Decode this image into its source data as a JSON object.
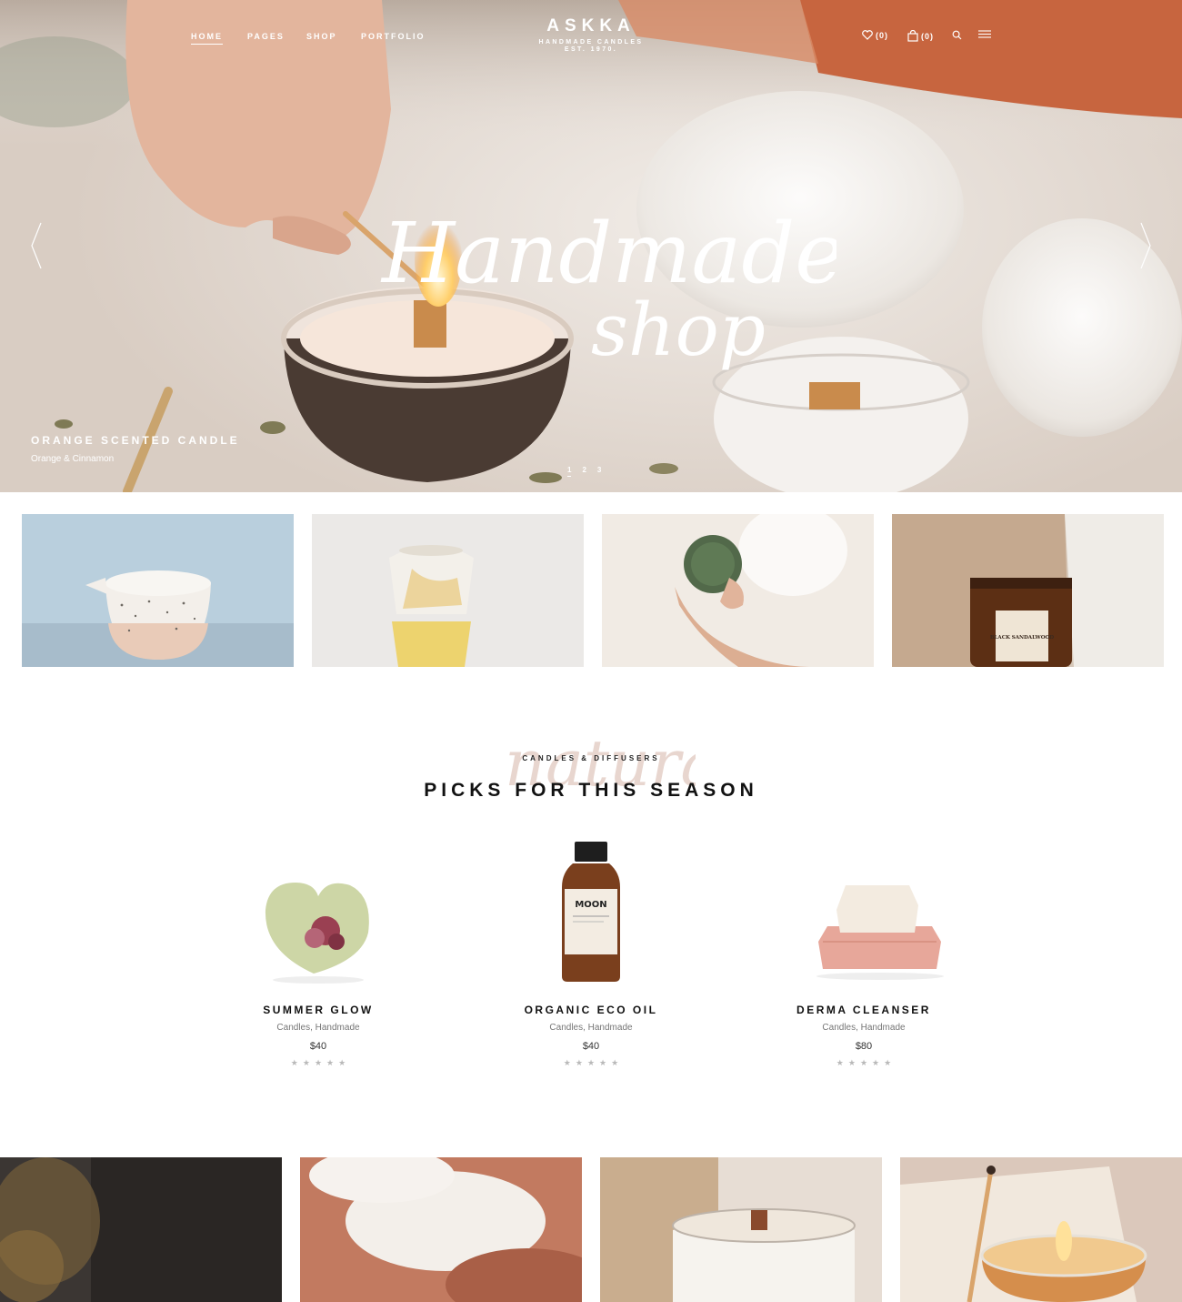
{
  "header": {
    "nav": [
      {
        "label": "HOME",
        "active": true
      },
      {
        "label": "PAGES",
        "active": false
      },
      {
        "label": "SHOP",
        "active": false
      },
      {
        "label": "PORTFOLIO",
        "active": false
      }
    ],
    "logo": {
      "name": "ASKKA",
      "tagline": "HANDMADE CANDLES",
      "established": "EST. 1970."
    },
    "wishlist": {
      "icon": "heart-icon",
      "count": "(0)"
    },
    "cart": {
      "icon": "bag-icon",
      "count": "(0)"
    },
    "search_icon": "search-icon",
    "menu_icon": "hamburger-icon"
  },
  "hero": {
    "script_line_1": "Handmade",
    "script_line_2": "shop",
    "slide_title": "ORANGE SCENTED CANDLE",
    "slide_subtitle": "Orange & Cinnamon",
    "pagination": [
      "1",
      "2",
      "3"
    ],
    "active_slide": 1,
    "prev_icon": "chevron-left-icon",
    "next_icon": "chevron-right-icon"
  },
  "banners": [
    {
      "name": "speckled-pitcher-candle"
    },
    {
      "name": "yellow-marble-holder"
    },
    {
      "name": "hand-holding-green-tin"
    },
    {
      "name": "amber-jar-candle",
      "label_text": "BLACK SANDALWOOD"
    }
  ],
  "picks": {
    "script_background": "natural",
    "eyebrow": "CANDLES & DIFFUSERS",
    "title": "PICKS FOR THIS SEASON",
    "products": [
      {
        "name": "SUMMER GLOW",
        "category": "Candles, Handmade",
        "price": "$40",
        "rating": 0
      },
      {
        "name": "ORGANIC ECO OIL",
        "category": "Candles, Handmade",
        "price": "$40",
        "rating": 0,
        "bottle_label": "MOON"
      },
      {
        "name": "DERMA CLEANSER",
        "category": "Candles, Handmade",
        "price": "$80",
        "rating": 0
      }
    ]
  },
  "colors": {
    "accent": "#c8643a",
    "text_dark": "#111111",
    "text_muted": "#777777",
    "star_empty": "#b9b9b9"
  }
}
